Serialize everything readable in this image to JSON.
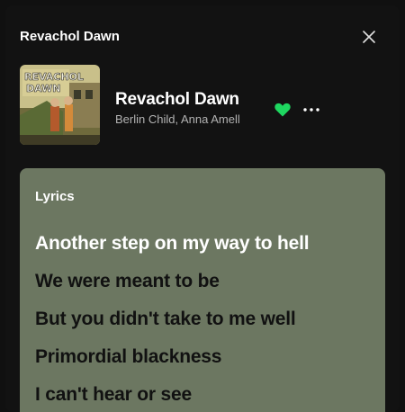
{
  "header": {
    "title": "Revachol Dawn"
  },
  "track": {
    "title": "Revachol Dawn",
    "artists": "Berlin Child, Anna Amell",
    "liked": true,
    "cover_art_text": [
      "REVACHOL",
      "DAWN"
    ]
  },
  "lyrics": {
    "heading": "Lyrics",
    "lines": [
      "Another step on my way to hell",
      "We were meant to be",
      "But you didn't take to me well",
      "Primordial blackness",
      "I can't hear or see"
    ],
    "active_line_index": 0
  },
  "icons": {
    "close": "close-icon",
    "heart": "heart-filled-icon",
    "more": "more-options-icon"
  },
  "colors": {
    "background": "#121212",
    "lyrics_card": "#6c7761",
    "active_lyric": "#ffffff",
    "inactive_lyric": "#111111",
    "liked_heart": "#1ed760",
    "secondary_text": "#b3b3b3"
  }
}
